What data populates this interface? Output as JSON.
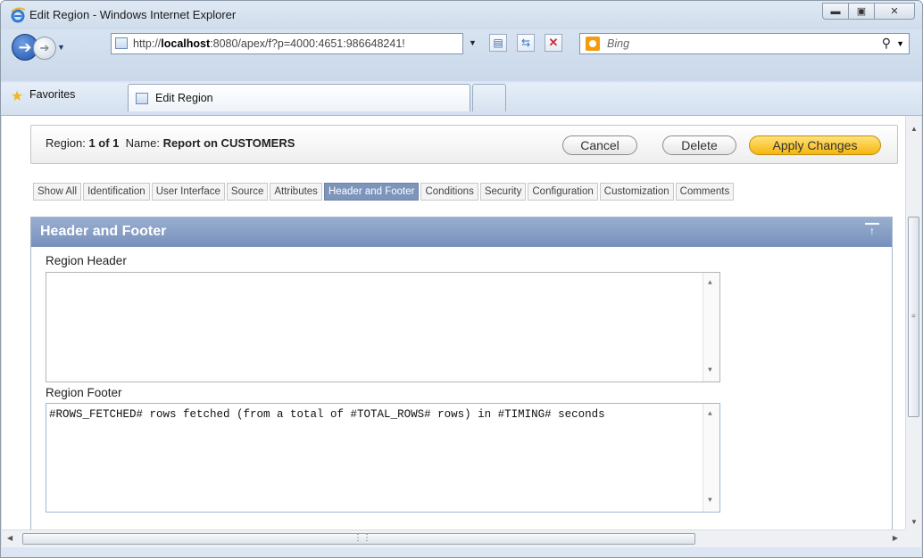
{
  "window": {
    "title": "Edit Region - Windows Internet Explorer",
    "minimize_icon": "minimize-icon",
    "maximize_icon": "maximize-icon",
    "close_icon": "close-icon"
  },
  "navbar": {
    "url_prefix": "http://",
    "url_host": "localhost",
    "url_rest": ":8080/apex/f?p=4000:4651:986648241!",
    "search_placeholder": "Bing",
    "favorites_label": "Favorites",
    "tab_label": "Edit Region"
  },
  "region": {
    "label_prefix": "Region:",
    "count": "1 of 1",
    "name_label": "Name:",
    "name": "Report on CUSTOMERS",
    "cancel_label": "Cancel",
    "delete_label": "Delete",
    "apply_label": "Apply Changes"
  },
  "section_tabs": [
    {
      "label": "Show All",
      "active": false
    },
    {
      "label": "Identification",
      "active": false
    },
    {
      "label": "User Interface",
      "active": false
    },
    {
      "label": "Source",
      "active": false
    },
    {
      "label": "Attributes",
      "active": false
    },
    {
      "label": "Header and Footer",
      "active": true
    },
    {
      "label": "Conditions",
      "active": false
    },
    {
      "label": "Security",
      "active": false
    },
    {
      "label": "Configuration",
      "active": false
    },
    {
      "label": "Customization",
      "active": false
    },
    {
      "label": "Comments",
      "active": false
    }
  ],
  "panel": {
    "title": "Header and Footer",
    "region_header_label": "Region Header",
    "region_header_value": "",
    "region_footer_label": "Region Footer",
    "region_footer_value": "#ROWS_FETCHED# rows fetched (from a total of #TOTAL_ROWS# rows) in #TIMING# seconds"
  },
  "colors": {
    "active_tab": "#7d94bb",
    "panel_header": "#8aa1c6",
    "apply_button": "#f6b60e"
  }
}
